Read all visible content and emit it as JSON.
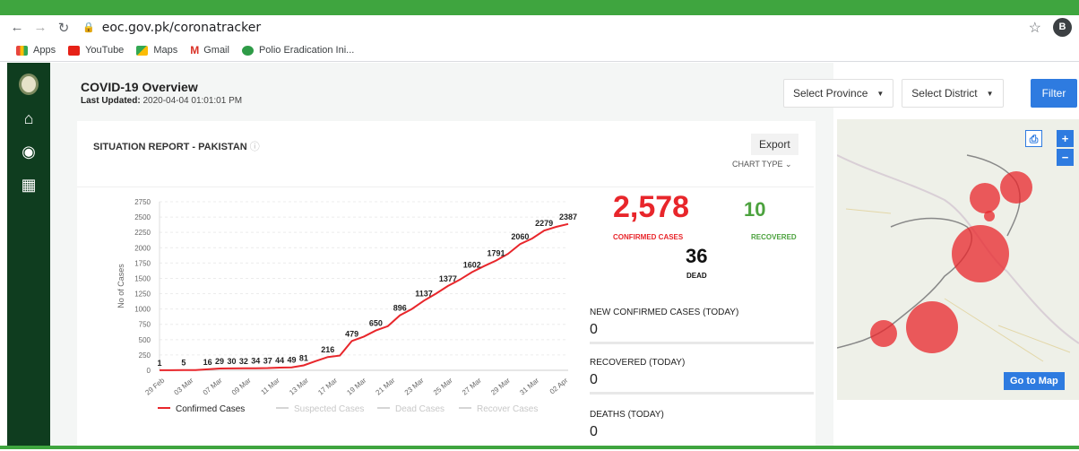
{
  "browser": {
    "url": "eoc.gov.pk/coronatracker",
    "profile_initial": "B",
    "bookmarks": [
      {
        "label": "Apps",
        "color": "#e8453c"
      },
      {
        "label": "YouTube",
        "color": "#e62117"
      },
      {
        "label": "Maps",
        "color": "#34a853"
      },
      {
        "label": "Gmail",
        "color": "#d93025"
      },
      {
        "label": "Polio Eradication Ini...",
        "color": "#2e9b47"
      }
    ]
  },
  "header": {
    "title": "COVID-19 Overview",
    "updated_label": "Last Updated:",
    "updated_value": "2020-04-04 01:01:01 PM"
  },
  "filters": {
    "province": "Select Province",
    "district": "Select District",
    "filter_label": "Filter"
  },
  "report": {
    "title": "SITUATION REPORT - PAKISTAN",
    "export_label": "Export",
    "chart_type_label": "CHART TYPE"
  },
  "stats": {
    "confirmed": "2,578",
    "confirmed_label": "CONFIRMED CASES",
    "recovered": "10",
    "recovered_label": "RECOVERED",
    "dead": "36",
    "dead_label": "DEAD",
    "new_confirmed_label": "NEW CONFIRMED CASES (TODAY)",
    "new_confirmed_value": "0",
    "recovered_today_label": "RECOVERED (TODAY)",
    "recovered_today_value": "0",
    "deaths_today_label": "DEATHS (TODAY)",
    "deaths_today_value": "0"
  },
  "map": {
    "go_to_map_label": "Go to Map"
  },
  "colors": {
    "sidebar": "#0f3d1f",
    "confirmed": "#e8262b",
    "recovered": "#4ca23e",
    "accent": "#2e7be0",
    "line": "#e8262b"
  },
  "chart_data": {
    "type": "line",
    "title": "",
    "xlabel": "",
    "ylabel": "No of Cases",
    "ylim": [
      0,
      2750
    ],
    "y_ticks": [
      0,
      250,
      500,
      750,
      1000,
      1250,
      1500,
      1750,
      2000,
      2250,
      2500,
      2750
    ],
    "x_tick_labels": [
      "29 Feb",
      "03 Mar",
      "07 Mar",
      "09 Mar",
      "11 Mar",
      "13 Mar",
      "17 Mar",
      "19 Mar",
      "21 Mar",
      "23 Mar",
      "25 Mar",
      "27 Mar",
      "29 Mar",
      "31 Mar",
      "02 Apr"
    ],
    "series": [
      {
        "name": "Confirmed Cases",
        "x": [
          0,
          1,
          2,
          3,
          4,
          5,
          6,
          7,
          8,
          9,
          10,
          11,
          12,
          13,
          14,
          15,
          16,
          17,
          18,
          19,
          20,
          21,
          22,
          23,
          24,
          25,
          26,
          27,
          28,
          29,
          30,
          31,
          32,
          33,
          34
        ],
        "values": [
          1,
          1,
          5,
          5,
          16,
          29,
          30,
          32,
          34,
          37,
          44,
          49,
          81,
          150,
          216,
          240,
          479,
          550,
          650,
          720,
          896,
          1000,
          1137,
          1250,
          1377,
          1480,
          1602,
          1700,
          1791,
          1900,
          2060,
          2150,
          2279,
          2340,
          2387
        ],
        "labels": {
          "0": "1",
          "2": "5",
          "4": "16",
          "5": "29",
          "6": "30",
          "7": "32",
          "8": "34",
          "9": "37",
          "10": "44",
          "11": "49",
          "12": "81",
          "14": "216",
          "16": "479",
          "18": "650",
          "20": "896",
          "22": "1137",
          "24": "1377",
          "26": "1602",
          "28": "1791",
          "30": "2060",
          "32": "2279",
          "34": "2387"
        }
      },
      {
        "name": "Suspected Cases",
        "values": []
      },
      {
        "name": "Dead Cases",
        "values": []
      },
      {
        "name": "Recover Cases",
        "values": []
      }
    ],
    "legend": [
      "Confirmed Cases",
      "Suspected Cases",
      "Dead Cases",
      "Recover Cases"
    ],
    "legend_position": "bottom",
    "grid": true
  }
}
